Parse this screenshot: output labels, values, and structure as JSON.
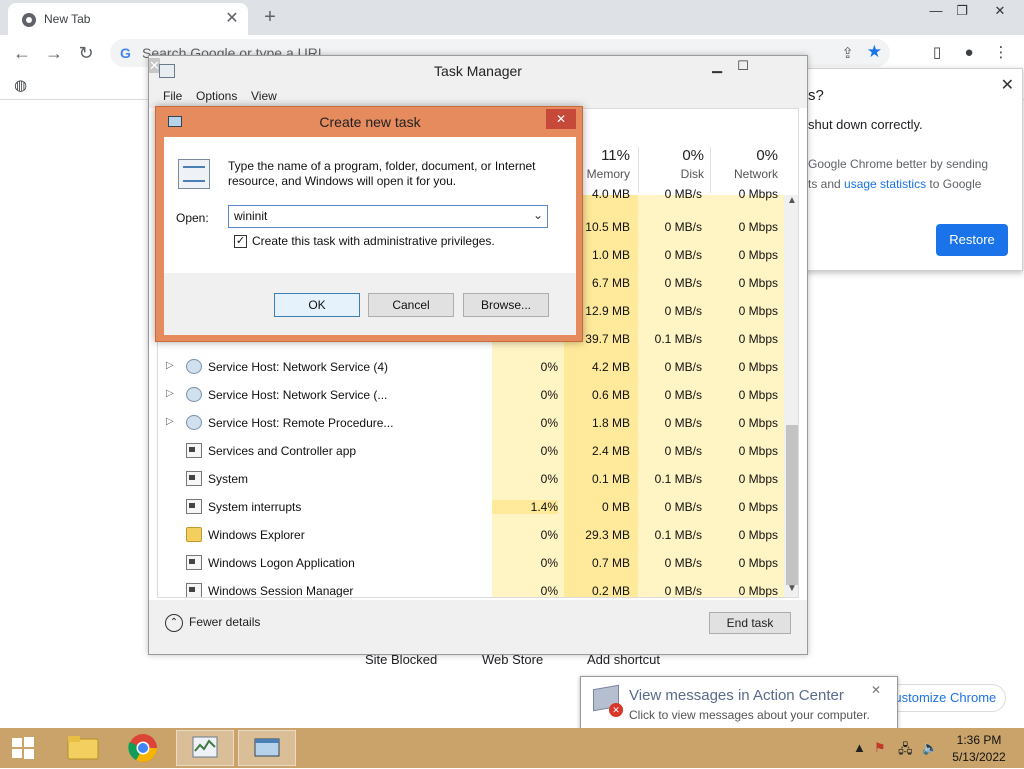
{
  "chrome": {
    "tab_title": "New Tab",
    "new_tab_symbol": "+",
    "omnibox_placeholder": "Search Google or type a URL",
    "google_mark": "G",
    "ntp_links": [
      "Site Blocked",
      "Web Store",
      "Add shortcut"
    ],
    "customize_label": "Customize Chrome",
    "restore_popup": {
      "title_fragment": "s?",
      "message_fragment": "shut down correctly.",
      "line1_text": "Google Chrome better by sending",
      "line2_prefix": "ts and ",
      "line2_link": "usage statistics",
      "line2_suffix": " to Google",
      "restore_label": "Restore"
    }
  },
  "task_manager": {
    "title": "Task Manager",
    "menu": [
      "File",
      "Options",
      "View"
    ],
    "columns": [
      {
        "pct": "11%",
        "label": "Memory"
      },
      {
        "pct": "0%",
        "label": "Disk"
      },
      {
        "pct": "0%",
        "label": "Network"
      }
    ],
    "partial_rows": [
      {
        "memory": "4.0 MB",
        "disk": "0 MB/s",
        "network": "0 Mbps"
      },
      {
        "memory": "10.5 MB",
        "disk": "0 MB/s",
        "network": "0 Mbps"
      },
      {
        "memory": "1.0 MB",
        "disk": "0 MB/s",
        "network": "0 Mbps"
      },
      {
        "memory": "6.7 MB",
        "disk": "0 MB/s",
        "network": "0 Mbps"
      },
      {
        "memory": "12.9 MB",
        "disk": "0 MB/s",
        "network": "0 Mbps"
      },
      {
        "memory": "39.7 MB",
        "disk": "0.1 MB/s",
        "network": "0 Mbps"
      }
    ],
    "rows": [
      {
        "name": "Service Host: Network Service (4)",
        "expandable": true,
        "icon": "gear-icon",
        "cpu": "0%",
        "memory": "4.2 MB",
        "disk": "0 MB/s",
        "network": "0 Mbps"
      },
      {
        "name": "Service Host: Network Service (...",
        "expandable": true,
        "icon": "gear-icon",
        "cpu": "0%",
        "memory": "0.6 MB",
        "disk": "0 MB/s",
        "network": "0 Mbps"
      },
      {
        "name": "Service Host: Remote Procedure...",
        "expandable": true,
        "icon": "gear-icon",
        "cpu": "0%",
        "memory": "1.8 MB",
        "disk": "0 MB/s",
        "network": "0 Mbps"
      },
      {
        "name": "Services and Controller app",
        "expandable": false,
        "icon": "app-icon",
        "cpu": "0%",
        "memory": "2.4 MB",
        "disk": "0 MB/s",
        "network": "0 Mbps"
      },
      {
        "name": "System",
        "expandable": false,
        "icon": "app-icon",
        "cpu": "0%",
        "memory": "0.1 MB",
        "disk": "0.1 MB/s",
        "network": "0 Mbps"
      },
      {
        "name": "System interrupts",
        "expandable": false,
        "icon": "app-icon",
        "cpu": "1.4%",
        "memory": "0 MB",
        "disk": "0 MB/s",
        "network": "0 Mbps"
      },
      {
        "name": "Windows Explorer",
        "expandable": false,
        "icon": "folder-icon",
        "cpu": "0%",
        "memory": "29.3 MB",
        "disk": "0.1 MB/s",
        "network": "0 Mbps"
      },
      {
        "name": "Windows Logon Application",
        "expandable": false,
        "icon": "app-icon",
        "cpu": "0%",
        "memory": "0.7 MB",
        "disk": "0 MB/s",
        "network": "0 Mbps"
      },
      {
        "name": "Windows Session Manager",
        "expandable": false,
        "icon": "app-icon",
        "cpu": "0%",
        "memory": "0.2 MB",
        "disk": "0 MB/s",
        "network": "0 Mbps"
      }
    ],
    "fewer_details_label": "Fewer details",
    "end_task_label": "End task"
  },
  "run_dialog": {
    "title": "Create new task",
    "description": "Type the name of a program, folder, document, or Internet resource, and Windows will open it for you.",
    "open_label": "Open:",
    "open_value": "wininit",
    "admin_label": "Create this task with administrative privileges.",
    "admin_checked": true,
    "ok_label": "OK",
    "cancel_label": "Cancel",
    "browse_label": "Browse..."
  },
  "action_center": {
    "title": "View messages in Action Center",
    "subtitle": "Click to view messages about your computer."
  },
  "taskbar": {
    "time": "1:36 PM",
    "date": "5/13/2022"
  },
  "colors": {
    "dialog_frame": "#e58b5d",
    "taskbar": "#c9a36a",
    "cpu_column": "#fff4c4",
    "memory_column": "#ffe99a",
    "restore_button": "#1a73e8"
  }
}
